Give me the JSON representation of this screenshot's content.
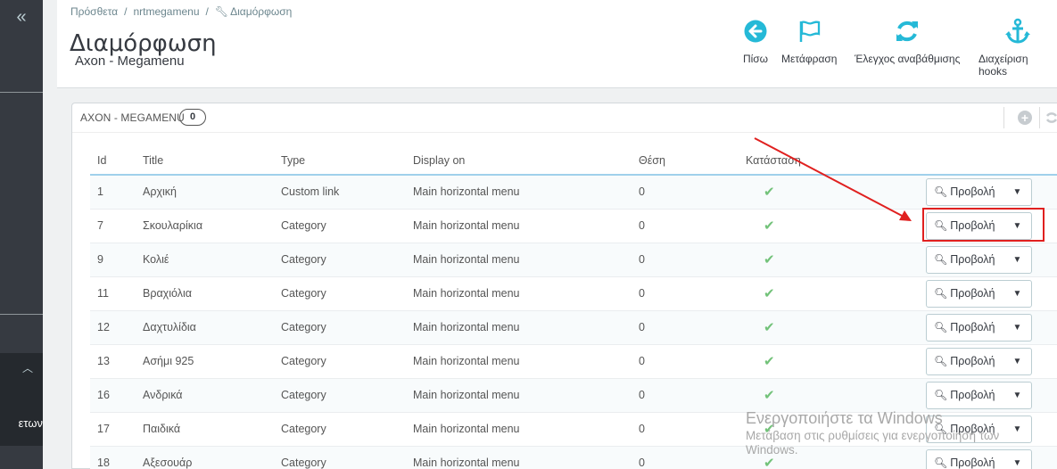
{
  "breadcrumb": [
    "Πρόσθετα",
    "nrtmegamenu",
    "Διαμόρφωση"
  ],
  "page": {
    "title": "Διαμόρφωση",
    "subtitle": "Axon - Megamenu"
  },
  "toolbar": {
    "back": "Πίσω",
    "translate": "Μετάφραση",
    "upgrade_check": "Έλεγχος αναβάθμισης",
    "manage_hooks": "Διαχείριση hooks"
  },
  "sidebar": {
    "active_label_fragment": "ετων"
  },
  "panel": {
    "title": "AXON - MEGAMENU",
    "count": "0"
  },
  "table": {
    "headers": [
      "Id",
      "Title",
      "Type",
      "Display on",
      "Θέση",
      "Κατάσταση"
    ],
    "rows": [
      {
        "id": "1",
        "title": "Αρχική",
        "type": "Custom link",
        "display": "Main horizontal menu",
        "position": "0",
        "action": "Προβολή"
      },
      {
        "id": "7",
        "title": "Σκουλαρίκια",
        "type": "Category",
        "display": "Main horizontal menu",
        "position": "0",
        "action": "Προβολή"
      },
      {
        "id": "9",
        "title": "Κολιέ",
        "type": "Category",
        "display": "Main horizontal menu",
        "position": "0",
        "action": "Προβολή"
      },
      {
        "id": "11",
        "title": "Βραχιόλια",
        "type": "Category",
        "display": "Main horizontal menu",
        "position": "0",
        "action": "Προβολή"
      },
      {
        "id": "12",
        "title": "Δαχτυλίδια",
        "type": "Category",
        "display": "Main horizontal menu",
        "position": "0",
        "action": "Προβολή"
      },
      {
        "id": "13",
        "title": "Ασήμι 925",
        "type": "Category",
        "display": "Main horizontal menu",
        "position": "0",
        "action": "Προβολή"
      },
      {
        "id": "16",
        "title": "Ανδρικά",
        "type": "Category",
        "display": "Main horizontal menu",
        "position": "0",
        "action": "Προβολή"
      },
      {
        "id": "17",
        "title": "Παιδικά",
        "type": "Category",
        "display": "Main horizontal menu",
        "position": "0",
        "action": "Προβολή"
      },
      {
        "id": "18",
        "title": "Αξεσουάρ",
        "type": "Category",
        "display": "Main horizontal menu",
        "position": "0",
        "action": "Προβολή"
      }
    ]
  },
  "watermark": {
    "line1": "Ενεργοποιήστε τα Windows",
    "line2": "Μετάβαση στις ρυθμίσεις για ενεργοποίηση των",
    "line3": "Windows."
  },
  "colors": {
    "accent": "#25b9d7",
    "status_ok": "#72c279",
    "highlight": "#e0201f"
  }
}
